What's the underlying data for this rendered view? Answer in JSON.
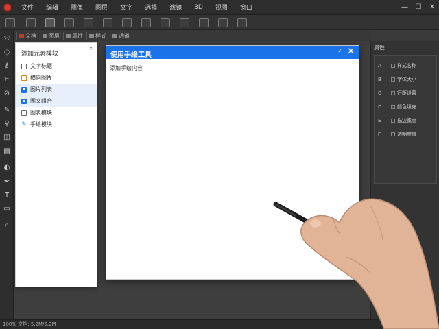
{
  "menu": {
    "items": [
      "文件",
      "编辑",
      "图像",
      "图层",
      "文字",
      "选择",
      "滤镜",
      "3D",
      "视图",
      "窗口"
    ],
    "controls": {
      "minimize": "—",
      "maximize": "☐",
      "close": "✕"
    }
  },
  "doc_tabs": [
    "文档",
    "图层",
    "属性",
    "样式",
    "通道"
  ],
  "side_panel": {
    "title": "添加元素模块",
    "close": "×",
    "items": [
      {
        "label": "文字标题",
        "icon": "checkbox-icon",
        "selected": false
      },
      {
        "label": "横向图片",
        "icon": "image-icon",
        "selected": false
      },
      {
        "label": "图片列表",
        "icon": "list-icon",
        "selected": true
      },
      {
        "label": "图文组合",
        "icon": "media-icon",
        "selected": true
      },
      {
        "label": "图表模块",
        "icon": "chart-icon",
        "selected": false
      },
      {
        "label": "手绘模块",
        "icon": "pen-icon",
        "selected": false
      }
    ]
  },
  "dialog": {
    "title": "使用手绘工具",
    "minimize": "✓",
    "close": "✕",
    "body_text": "添加手绘内容"
  },
  "props": {
    "title": "属性",
    "rows": [
      {
        "key": "A",
        "val": "样式名称"
      },
      {
        "key": "B",
        "val": "字体大小"
      },
      {
        "key": "C",
        "val": "行距设置"
      },
      {
        "key": "D",
        "val": "颜色填充"
      },
      {
        "key": "E",
        "val": "描边宽度"
      },
      {
        "key": "F",
        "val": "透明度值"
      }
    ]
  },
  "status": {
    "text": "100%  文档: 5.2M/5.2M"
  },
  "colors": {
    "accent": "#1a73e8",
    "background": "#3a3a3a",
    "panel": "#ffffff",
    "logo": "#d83a2b"
  }
}
